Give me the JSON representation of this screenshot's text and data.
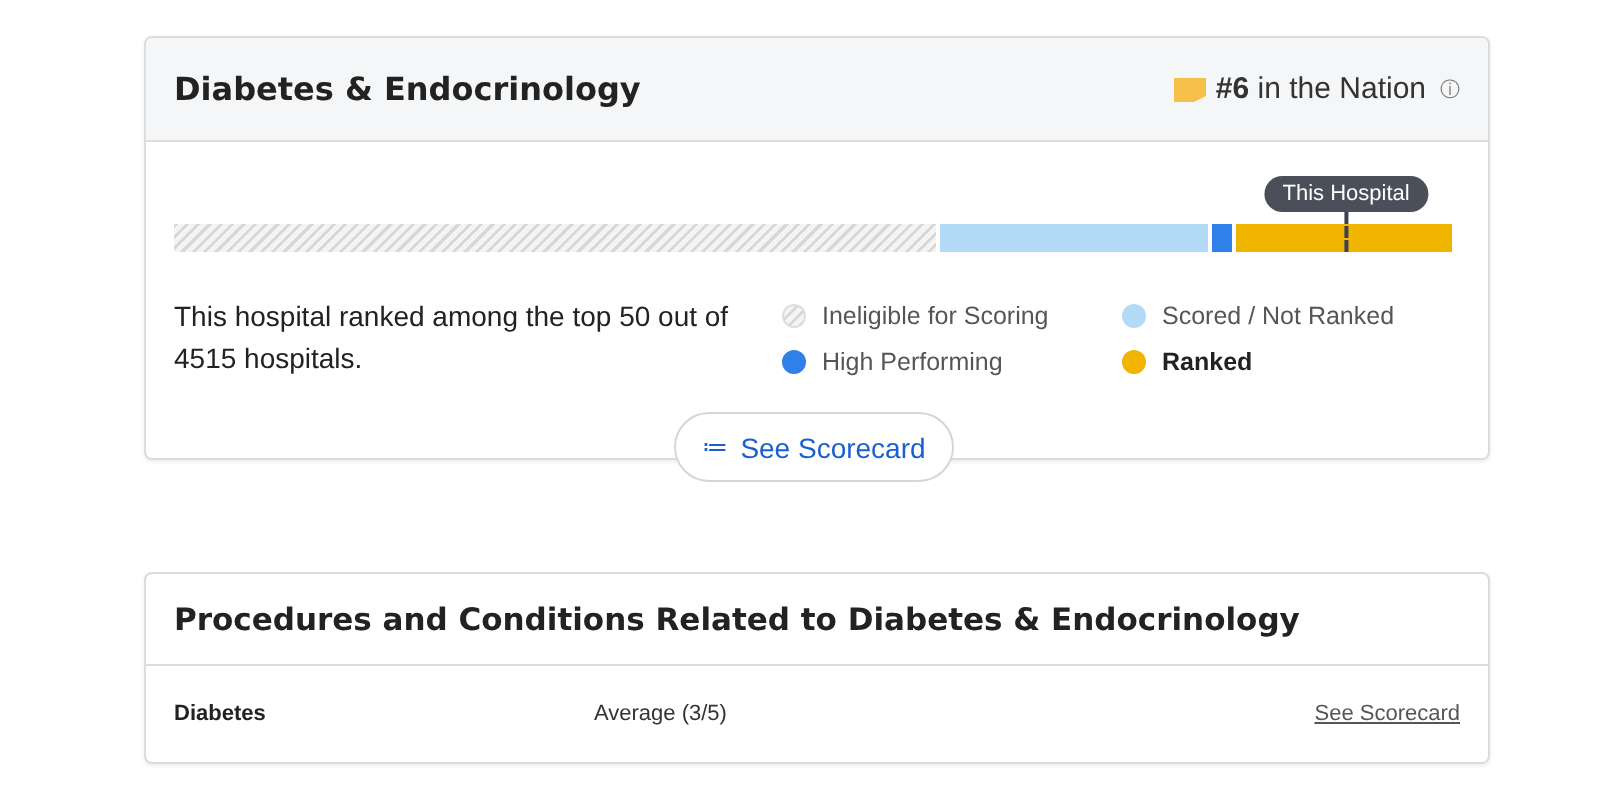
{
  "specialty_card": {
    "title": "Diabetes & Endocrinology",
    "rank": {
      "number": "#6",
      "text": "in the Nation",
      "info_icon": "ⓘ"
    },
    "bar": {
      "segments": [
        {
          "kind": "hatched"
        },
        {
          "kind": "solid",
          "color": "#b3daf7"
        },
        {
          "kind": "solid",
          "color": "#2f80e8"
        },
        {
          "kind": "solid",
          "color": "#f1b500"
        }
      ],
      "marker": {
        "label": "This Hospital"
      }
    },
    "summary": "This hospital ranked among the top 50 out of 4515 hospitals.",
    "legend": [
      {
        "kind": "hatched",
        "label": "Ineligible for Scoring",
        "emphasized": false
      },
      {
        "kind": "solid",
        "label": "Scored / Not Ranked",
        "color": "#b3daf7",
        "emphasized": false
      },
      {
        "kind": "solid",
        "label": "High Performing",
        "color": "#2f80e8",
        "emphasized": false
      },
      {
        "kind": "solid",
        "label": "Ranked",
        "color": "#f1b500",
        "emphasized": true
      }
    ],
    "button": {
      "icon": "≔",
      "label": "See Scorecard"
    }
  },
  "related_card": {
    "title": "Procedures and Conditions Related to Diabetes & Endocrinology",
    "rows": [
      {
        "name": "Diabetes",
        "rating": "Average (3/5)",
        "link": "See Scorecard"
      }
    ]
  }
}
